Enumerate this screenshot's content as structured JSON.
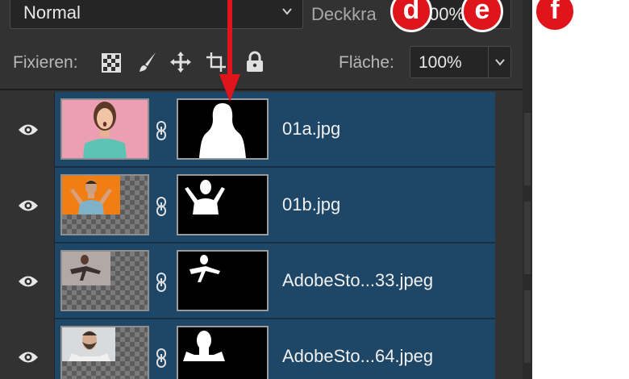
{
  "blend_mode": {
    "value": "Normal"
  },
  "opacity": {
    "label": "Deckkra",
    "value": "00%"
  },
  "lock": {
    "label": "Fixieren:",
    "tools": [
      "checkerboard-lock-icon",
      "brush-lock-icon",
      "move-lock-icon",
      "artboard-lock-icon",
      "padlock-icon"
    ]
  },
  "fill": {
    "label": "Fläche:",
    "value": "100%"
  },
  "layers": [
    {
      "name": "01a.jpg",
      "visible": true,
      "thumb_color": "#ec9eb2"
    },
    {
      "name": "01b.jpg",
      "visible": true,
      "thumb_color": "#f07e12"
    },
    {
      "name": "AdobeSto...33.jpeg",
      "visible": true,
      "thumb_color": "#b2a8a6"
    },
    {
      "name": "AdobeSto...64.jpeg",
      "visible": true,
      "thumb_color": "#d8dadc"
    }
  ],
  "callouts": {
    "d": "d",
    "e": "e",
    "f": "f"
  },
  "colors": {
    "selection": "#1e4666",
    "panel": "#323232",
    "callout": "#e0141b"
  }
}
